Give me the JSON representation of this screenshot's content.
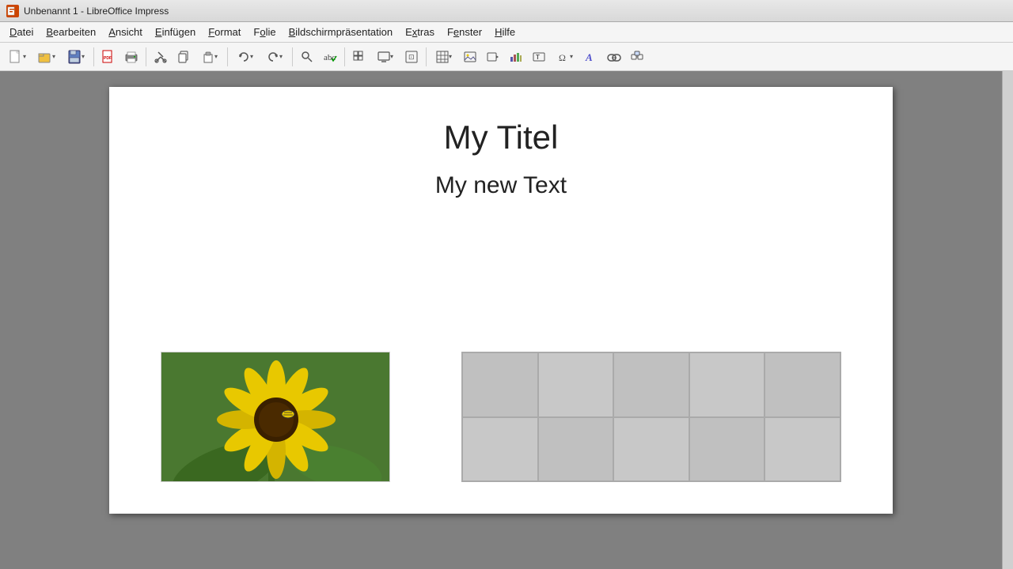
{
  "titlebar": {
    "title": "Unbenannt 1 - LibreOffice Impress",
    "app_name": "LI"
  },
  "menubar": {
    "items": [
      {
        "label": "Datei",
        "underline_index": 0
      },
      {
        "label": "Bearbeiten",
        "underline_index": 0
      },
      {
        "label": "Ansicht",
        "underline_index": 0
      },
      {
        "label": "Einfügen",
        "underline_index": 0
      },
      {
        "label": "Format",
        "underline_index": 0
      },
      {
        "label": "Folie",
        "underline_index": 0
      },
      {
        "label": "Bildschirmpräsentation",
        "underline_index": 0
      },
      {
        "label": "Extras",
        "underline_index": 0
      },
      {
        "label": "Fenster",
        "underline_index": 0
      },
      {
        "label": "Hilfe",
        "underline_index": 0
      }
    ]
  },
  "toolbar": {
    "buttons": [
      {
        "name": "new",
        "icon": "📄",
        "tooltip": "Neu"
      },
      {
        "name": "open",
        "icon": "📂",
        "tooltip": "Öffnen"
      },
      {
        "name": "save",
        "icon": "💾",
        "tooltip": "Speichern"
      },
      {
        "name": "export-pdf",
        "icon": "📤",
        "tooltip": "Als PDF exportieren"
      },
      {
        "name": "print",
        "icon": "🖨",
        "tooltip": "Drucken"
      },
      {
        "name": "cut",
        "icon": "✂",
        "tooltip": "Ausschneiden"
      },
      {
        "name": "copy",
        "icon": "📋",
        "tooltip": "Kopieren"
      },
      {
        "name": "paste",
        "icon": "📌",
        "tooltip": "Einfügen"
      },
      {
        "name": "undo",
        "icon": "↩",
        "tooltip": "Rückgängig"
      },
      {
        "name": "redo",
        "icon": "↪",
        "tooltip": "Wiederherstellen"
      },
      {
        "name": "find",
        "icon": "🔍",
        "tooltip": "Suchen"
      },
      {
        "name": "spellcheck",
        "icon": "✓",
        "tooltip": "Rechtschreibprüfung"
      },
      {
        "name": "grid",
        "icon": "⊞",
        "tooltip": "Raster"
      },
      {
        "name": "display",
        "icon": "▭",
        "tooltip": "Anzeige"
      },
      {
        "name": "tab-order",
        "icon": "⬛",
        "tooltip": "Tab-Reihenfolge"
      },
      {
        "name": "table",
        "icon": "▦",
        "tooltip": "Tabelle"
      },
      {
        "name": "image",
        "icon": "🖼",
        "tooltip": "Bild"
      },
      {
        "name": "movie",
        "icon": "🎬",
        "tooltip": "Film"
      },
      {
        "name": "chart",
        "icon": "📊",
        "tooltip": "Diagramm"
      },
      {
        "name": "textbox",
        "icon": "T",
        "tooltip": "Textfeld"
      },
      {
        "name": "special-chars",
        "icon": "Ω",
        "tooltip": "Sonderzeichen"
      },
      {
        "name": "fontwork",
        "icon": "A",
        "tooltip": "Fontwork"
      },
      {
        "name": "hyperlink",
        "icon": "🔗",
        "tooltip": "Hyperlink"
      },
      {
        "name": "extensions",
        "icon": "⚙",
        "tooltip": "Erweiterungen"
      }
    ]
  },
  "slide": {
    "title": "My Titel",
    "subtitle": "My new Text"
  },
  "table": {
    "cols": 5,
    "rows": 2
  }
}
